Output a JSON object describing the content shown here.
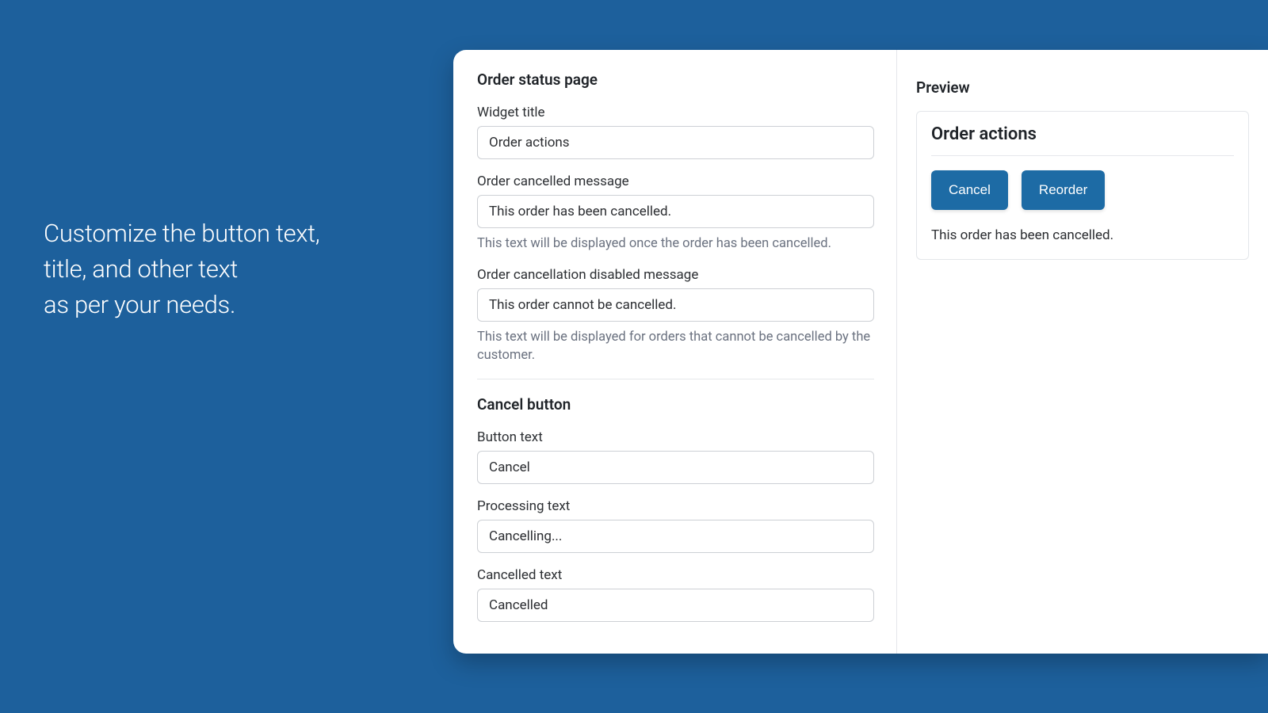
{
  "hero": {
    "line1": "Customize the button text,",
    "line2": "title, and other text",
    "line3": "as per your needs."
  },
  "form": {
    "section1_title": "Order status page",
    "widget_title_label": "Widget title",
    "widget_title_value": "Order actions",
    "cancelled_msg_label": "Order cancelled message",
    "cancelled_msg_value": "This order has been cancelled.",
    "cancelled_msg_help": "This text will be displayed once the order has been cancelled.",
    "disabled_msg_label": "Order cancellation disabled message",
    "disabled_msg_value": "This order cannot be cancelled.",
    "disabled_msg_help": "This text will be displayed for orders that cannot be cancelled by the customer.",
    "section2_title": "Cancel button",
    "button_text_label": "Button text",
    "button_text_value": "Cancel",
    "processing_label": "Processing text",
    "processing_value": "Cancelling...",
    "cancelled_text_label": "Cancelled text",
    "cancelled_text_value": "Cancelled"
  },
  "preview": {
    "heading": "Preview",
    "card_title": "Order actions",
    "cancel_btn": "Cancel",
    "reorder_btn": "Reorder",
    "status_text": "This order has been cancelled."
  }
}
